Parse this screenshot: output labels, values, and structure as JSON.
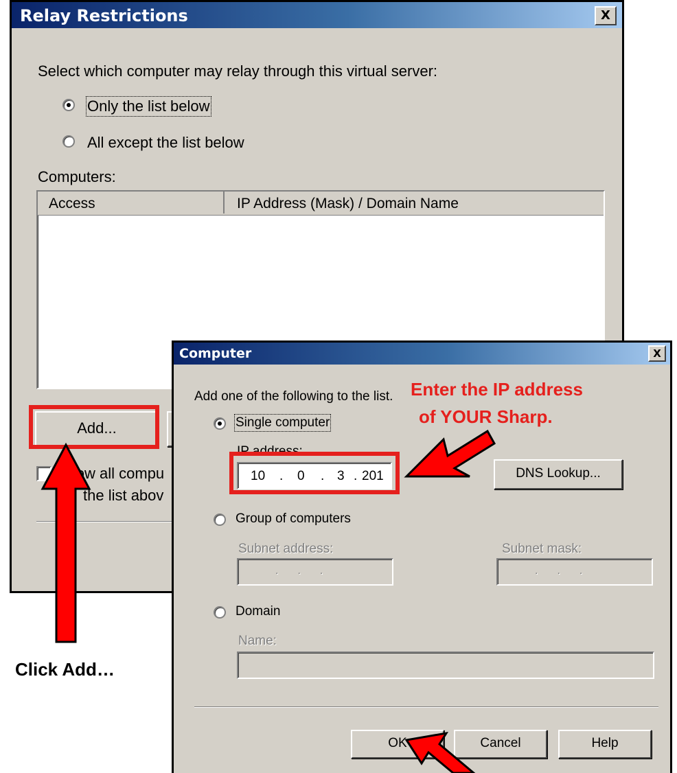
{
  "relay_dialog": {
    "title": "Relay Restrictions",
    "close_label": "X",
    "instruction": "Select which computer may relay through this virtual server:",
    "radio_only_list": "Only the list below",
    "radio_all_except": "All except the list below",
    "radio_selected": "Only the list below",
    "computers_label": "Computers:",
    "columns": [
      "Access",
      "IP Address (Mask) / Domain Name"
    ],
    "rows": [],
    "add_button": "Add...",
    "allow_checkbox_line1": "llow all compu",
    "allow_checkbox_line2": "the list abov",
    "allow_checked": false
  },
  "computer_dialog": {
    "title": "Computer",
    "close_label": "X",
    "instruction": "Add one of the following to the list.",
    "single_computer": "Single computer",
    "ip_address_label": "IP address:",
    "ip_octets": [
      "10",
      "0",
      "3",
      "201"
    ],
    "dns_lookup": "DNS Lookup...",
    "group_of_computers": "Group of computers",
    "subnet_address_label": "Subnet address:",
    "subnet_mask_label": "Subnet mask:",
    "domain": "Domain",
    "name_label": "Name:",
    "ok": "OK",
    "cancel": "Cancel",
    "help": "Help",
    "selected_option": "Single computer"
  },
  "annotations": {
    "ip_hint_line1": "Enter the IP address",
    "ip_hint_line2": "of YOUR Sharp.",
    "click_add": "Click Add…",
    "highlight_color": "#e5201d",
    "arrow_color": "#ff0000"
  }
}
